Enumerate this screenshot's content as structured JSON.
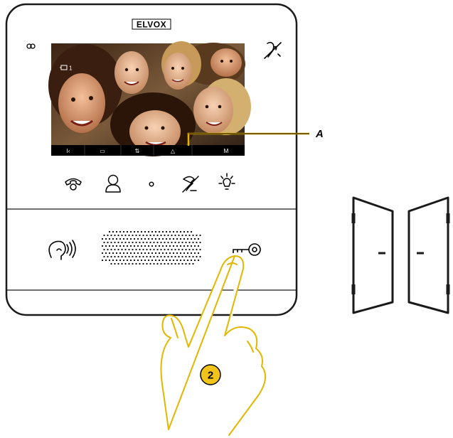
{
  "brand": {
    "logo_text": "ELVOX"
  },
  "screen": {
    "camera_indicator": "1",
    "menu_bar": [
      "ǀ‹",
      "▭",
      "⇅",
      "△",
      "M"
    ]
  },
  "callout": {
    "label": "A"
  },
  "step": {
    "number": "2"
  },
  "icons": {
    "status_left": "link-icon",
    "status_right": "hearing-loop-icon",
    "row1": [
      "phone-handset-icon",
      "user-icon",
      "dot-icon",
      "mute-icon",
      "light-icon"
    ],
    "lower": [
      "voice-icon",
      "speaker-grille",
      "key-door-icon"
    ]
  },
  "colors": {
    "device_outline": "#1a1a1a",
    "finger_outline": "#e3b600",
    "step_badge": "#f2c318",
    "screen_bar": "#000000"
  }
}
